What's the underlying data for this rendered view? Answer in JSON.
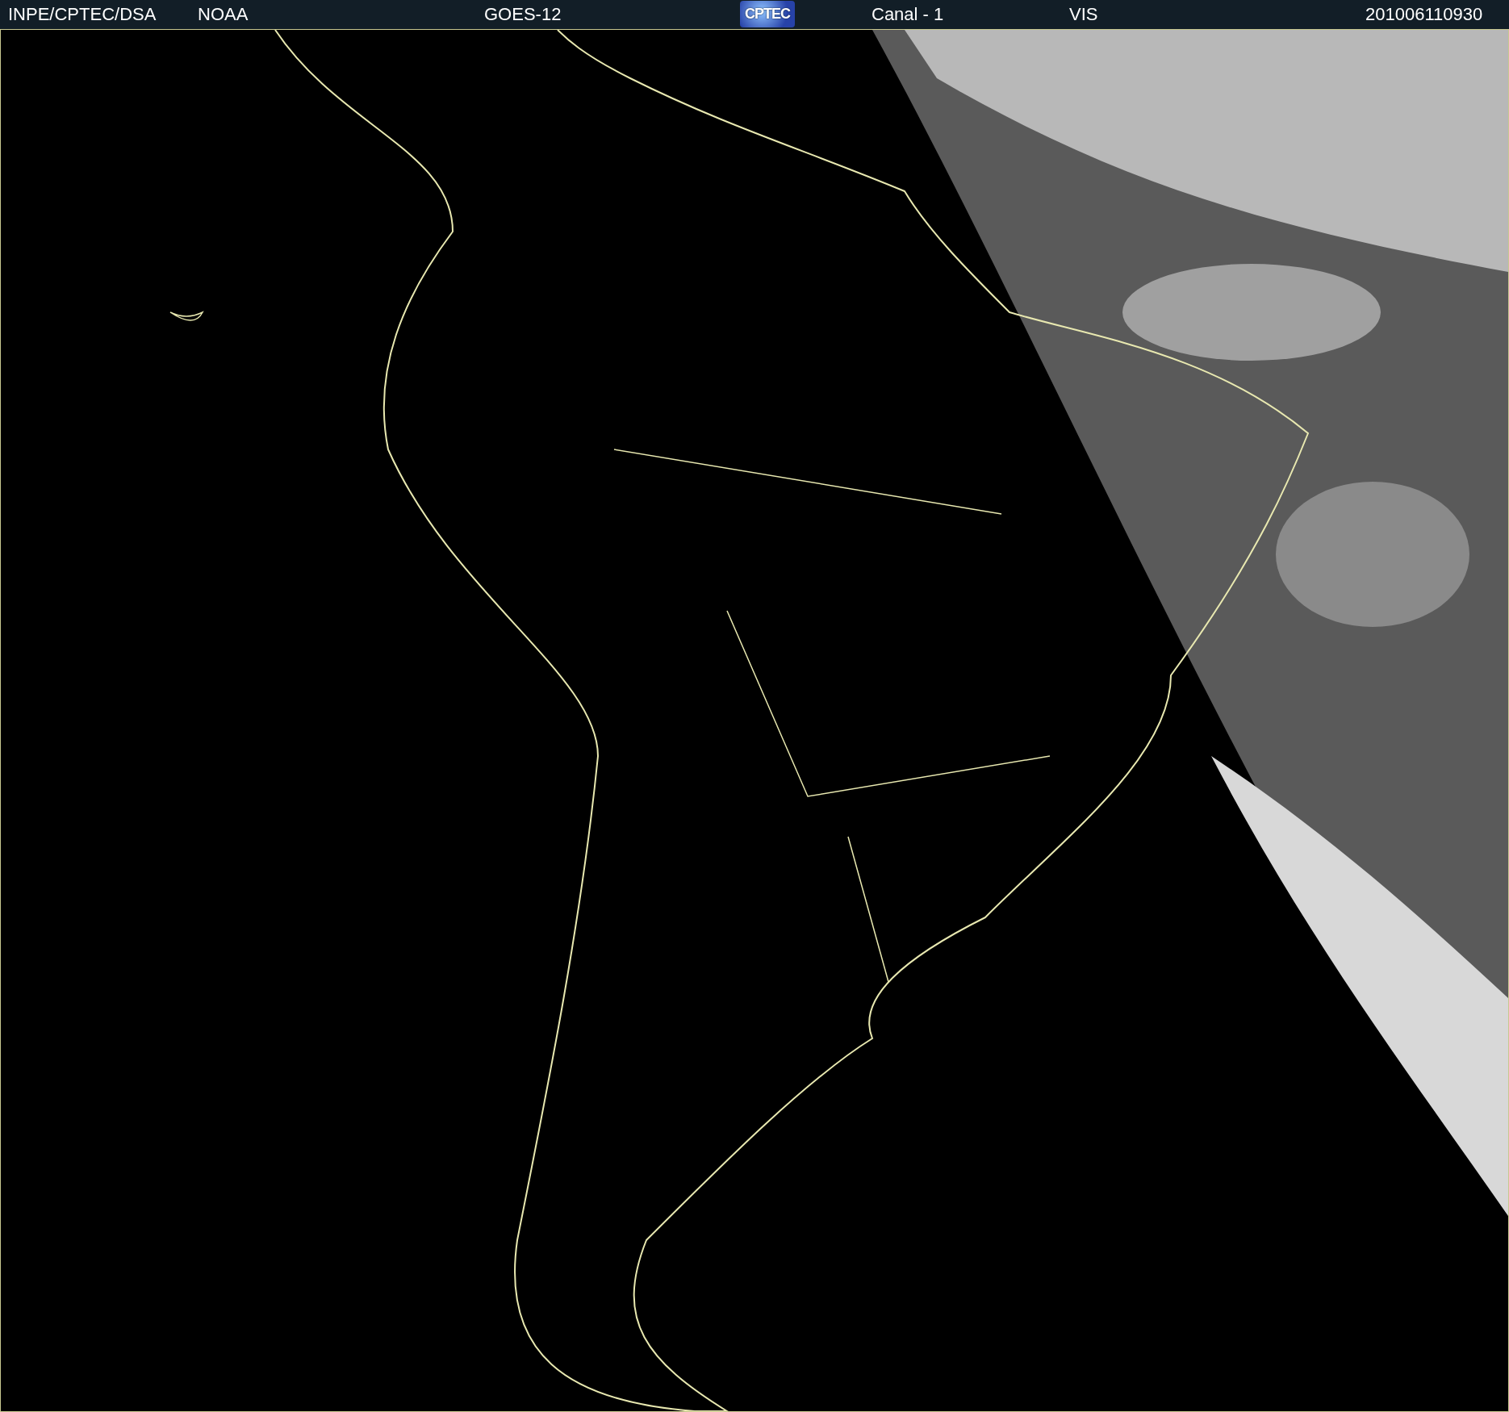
{
  "header": {
    "items": [
      {
        "kind": "text",
        "text": "INPE/CPTEC/DSA"
      },
      {
        "kind": "text",
        "text": "NOAA"
      },
      {
        "kind": "text",
        "text": "GOES-12"
      },
      {
        "kind": "logo",
        "text": "CPTEC"
      },
      {
        "kind": "text",
        "text": "Canal - 1"
      },
      {
        "kind": "text",
        "text": "VIS"
      },
      {
        "kind": "text",
        "text": "201006110930"
      }
    ]
  }
}
